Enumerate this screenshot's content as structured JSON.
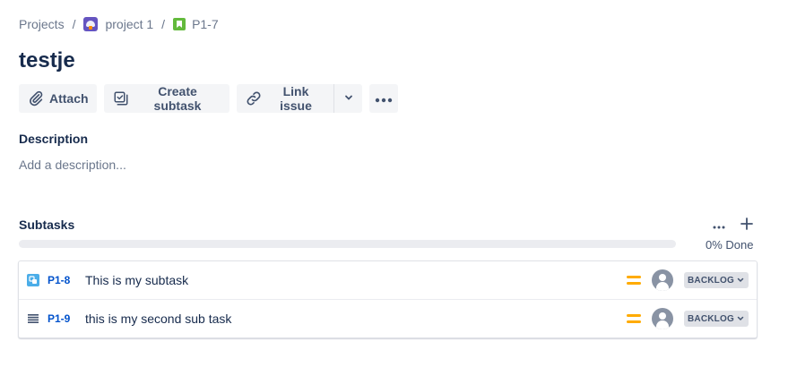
{
  "breadcrumbs": {
    "root": "Projects",
    "project": "project 1",
    "issue_key": "P1-7",
    "separator": "/"
  },
  "issue": {
    "title": "testje"
  },
  "toolbar": {
    "attach_label": "Attach",
    "create_subtask_label": "Create subtask",
    "link_issue_label": "Link issue"
  },
  "description": {
    "heading": "Description",
    "placeholder": "Add a description..."
  },
  "subtasks": {
    "heading": "Subtasks",
    "progress_percent": 0,
    "progress_label": "0% Done",
    "items": [
      {
        "type_icon": "subtask-icon",
        "key": "P1-8",
        "summary": "This is my subtask",
        "priority_icon": "priority-medium-icon",
        "status": "BACKLOG"
      },
      {
        "type_icon": "list-icon",
        "key": "P1-9",
        "summary": "this is my second sub task",
        "priority_icon": "priority-medium-icon",
        "status": "BACKLOG"
      }
    ]
  },
  "colors": {
    "link": "#0052cc",
    "priority_medium": "#ffab00",
    "project_avatar": "#6554c0",
    "story": "#63ba3c",
    "subtask": "#4bade8"
  }
}
